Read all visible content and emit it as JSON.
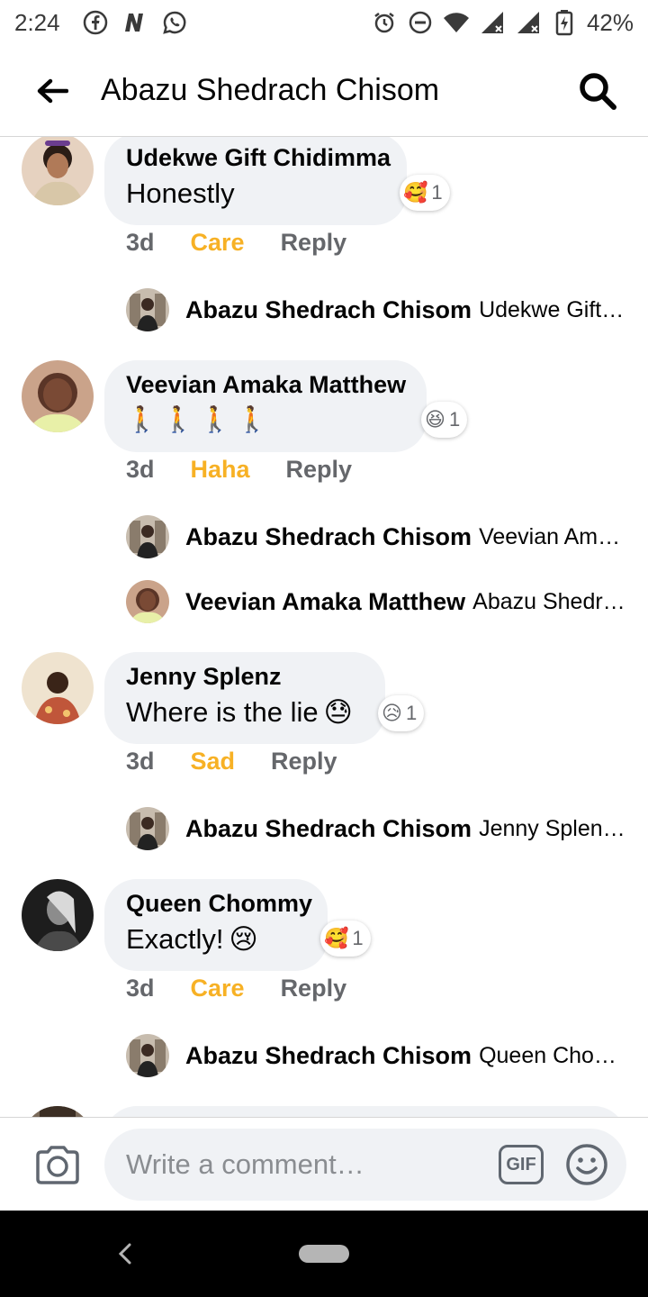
{
  "status_bar": {
    "time": "2:24",
    "battery": "42%"
  },
  "header": {
    "title": "Abazu Shedrach Chisom"
  },
  "comments": [
    {
      "author": "Udekwe Gift Chidimma",
      "text": "Honestly",
      "text_emoji": "",
      "reaction_emoji": "🥰",
      "reaction_count": "1",
      "time": "3d",
      "reaction_label": "Care",
      "reply_label": "Reply",
      "replies": [
        {
          "author": "Abazu Shedrach Chisom",
          "snippet": "Udekwe Gift…"
        }
      ]
    },
    {
      "author": "Veevian Amaka Matthew",
      "text": "🚶🚶🚶🚶",
      "text_emoji": "",
      "reaction_emoji": "😆",
      "reaction_count": "1",
      "time": "3d",
      "reaction_label": "Haha",
      "reply_label": "Reply",
      "replies": [
        {
          "author": "Abazu Shedrach Chisom",
          "snippet": "Veevian Am…"
        },
        {
          "author": "Veevian Amaka Matthew",
          "snippet": "Abazu Shedr…"
        }
      ]
    },
    {
      "author": "Jenny Splenz",
      "text": "Where is the lie",
      "text_emoji": "😓",
      "reaction_emoji": "😥",
      "reaction_count": "1",
      "time": "3d",
      "reaction_label": "Sad",
      "reply_label": "Reply",
      "replies": [
        {
          "author": "Abazu Shedrach Chisom",
          "snippet": "Jenny Splen…"
        }
      ]
    },
    {
      "author": "Queen Chommy",
      "text": "Exactly!",
      "text_emoji": "😢",
      "reaction_emoji": "🥰",
      "reaction_count": "1",
      "time": "3d",
      "reaction_label": "Care",
      "reply_label": "Reply",
      "replies": [
        {
          "author": "Abazu Shedrach Chisom",
          "snippet": "Queen Cho…"
        }
      ]
    }
  ],
  "composer": {
    "placeholder": "Write a comment…",
    "gif_label": "GIF"
  },
  "colors": {
    "reaction_label": "#f7b125",
    "bubble": "#f0f2f5",
    "meta_text": "#65676b"
  }
}
